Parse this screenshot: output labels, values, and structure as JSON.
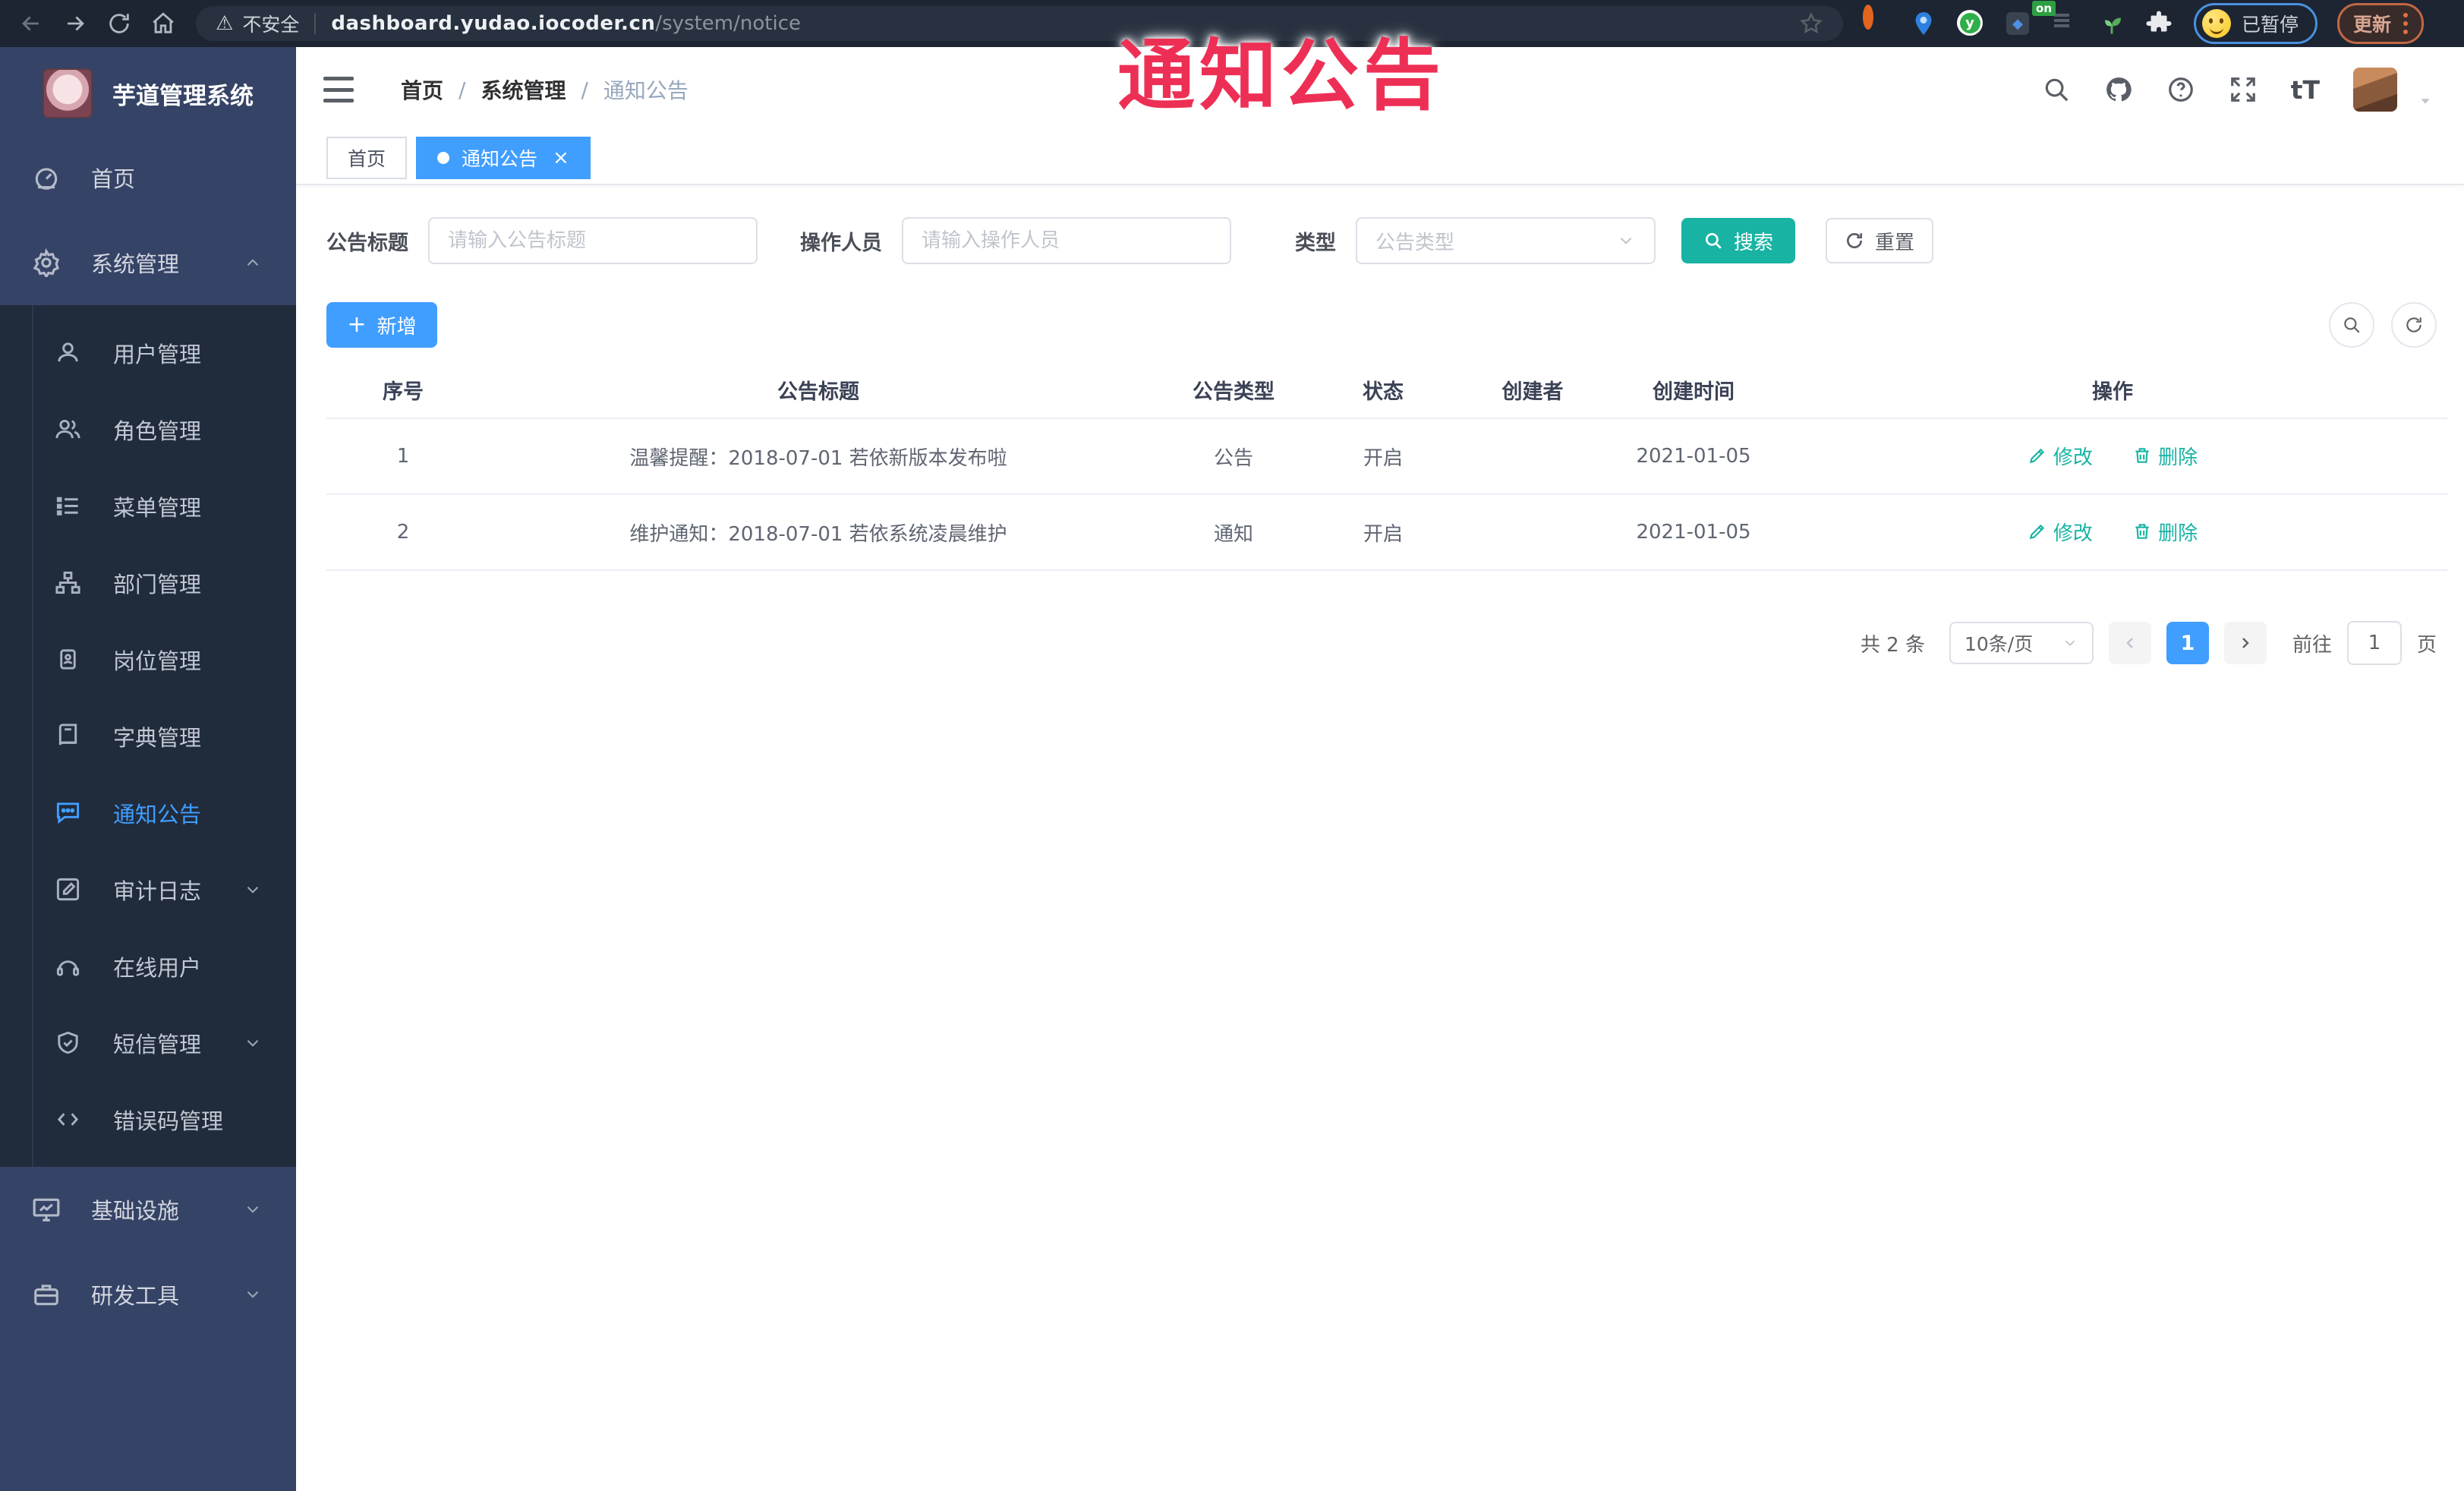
{
  "annotation": {
    "text": "通知公告"
  },
  "browser": {
    "security_label": "不安全",
    "url_host": "dashboard.yudao.iocoder.cn",
    "url_path": "/system/notice",
    "extension_badge": "on",
    "extension_letter": "y",
    "profile_label": "已暂停",
    "update_label": "更新"
  },
  "sidebar": {
    "title": "芋道管理系统",
    "items": [
      {
        "label": "首页"
      },
      {
        "label": "系统管理"
      },
      {
        "label": "基础设施"
      },
      {
        "label": "研发工具"
      }
    ],
    "submenu": [
      {
        "label": "用户管理"
      },
      {
        "label": "角色管理"
      },
      {
        "label": "菜单管理"
      },
      {
        "label": "部门管理"
      },
      {
        "label": "岗位管理"
      },
      {
        "label": "字典管理"
      },
      {
        "label": "通知公告"
      },
      {
        "label": "审计日志"
      },
      {
        "label": "在线用户"
      },
      {
        "label": "短信管理"
      },
      {
        "label": "错误码管理"
      }
    ]
  },
  "header": {
    "breadcrumb": [
      "首页",
      "系统管理",
      "通知公告"
    ],
    "separator": "/"
  },
  "tabs": [
    {
      "label": "首页"
    },
    {
      "label": "通知公告"
    }
  ],
  "filters": {
    "title_label": "公告标题",
    "title_placeholder": "请输入公告标题",
    "operator_label": "操作人员",
    "operator_placeholder": "请输入操作人员",
    "type_label": "类型",
    "type_placeholder": "公告类型",
    "search_label": "搜索",
    "reset_label": "重置"
  },
  "toolbar": {
    "add_label": "新增"
  },
  "table": {
    "columns": [
      "序号",
      "公告标题",
      "公告类型",
      "状态",
      "创建者",
      "创建时间",
      "操作"
    ],
    "rows": [
      {
        "no": "1",
        "title": "温馨提醒：2018-07-01 若依新版本发布啦",
        "type": "公告",
        "status": "开启",
        "creator": "",
        "created": "2021-01-05",
        "edit": "修改",
        "delete": "删除"
      },
      {
        "no": "2",
        "title": "维护通知：2018-07-01 若依系统凌晨维护",
        "type": "通知",
        "status": "开启",
        "creator": "",
        "created": "2021-01-05",
        "edit": "修改",
        "delete": "删除"
      }
    ]
  },
  "pagination": {
    "total": "共 2 条",
    "page_size": "10条/页",
    "page": "1",
    "goto_label": "前往",
    "goto_value": "1",
    "page_unit": "页"
  },
  "colors": {
    "primary": "#409EFF",
    "success_teal": "#18B3A3",
    "sidebar_bg": "#354366",
    "submenu_bg": "#202B3C",
    "annotation_red": "#EE2F55",
    "browser_bar": "#1C2531"
  }
}
